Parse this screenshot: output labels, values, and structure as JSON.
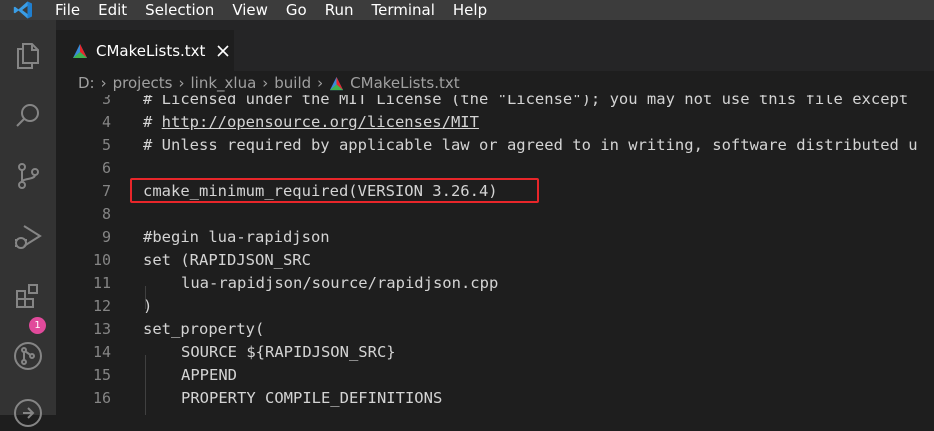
{
  "menubar": {
    "items": [
      "File",
      "Edit",
      "Selection",
      "View",
      "Go",
      "Run",
      "Terminal",
      "Help"
    ]
  },
  "activitybar": {
    "icons": [
      "explorer-icon",
      "search-icon",
      "source-control-icon",
      "run-debug-icon",
      "extensions-icon",
      "git-graph-icon",
      "remote-icon"
    ],
    "extensions_badge": "1"
  },
  "tab": {
    "label": "CMakeLists.txt",
    "close_label": "×"
  },
  "breadcrumb": [
    "D:",
    "projects",
    "link_xlua",
    "build",
    "CMakeLists.txt"
  ],
  "colors": {
    "activitybar": "#333333",
    "menubar": "#3c3c3c",
    "editor": "#1e1e1e",
    "highlight": "#e8262a",
    "badge": "#e14a9b"
  },
  "editor": {
    "lines": [
      {
        "n": "3",
        "text": "# Licensed under the MIT License (the \"License\"); you may not use this file except"
      },
      {
        "n": "4",
        "text": "# ",
        "url": "http://opensource.org/licenses/MIT"
      },
      {
        "n": "5",
        "text": "# Unless required by applicable law or agreed to in writing, software distributed u"
      },
      {
        "n": "6",
        "text": ""
      },
      {
        "n": "7",
        "text": "cmake_minimum_required(VERSION 3.26.4)"
      },
      {
        "n": "8",
        "text": ""
      },
      {
        "n": "9",
        "text": "#begin lua-rapidjson"
      },
      {
        "n": "10",
        "text": "set (RAPIDJSON_SRC"
      },
      {
        "n": "11",
        "text": "lua-rapidjson/source/rapidjson.cpp"
      },
      {
        "n": "12",
        "text": ")"
      },
      {
        "n": "13",
        "text": "set_property("
      },
      {
        "n": "14",
        "text": "SOURCE ${RAPIDJSON_SRC}"
      },
      {
        "n": "15",
        "text": "APPEND"
      },
      {
        "n": "16",
        "text": "PROPERTY COMPILE_DEFINITIONS"
      }
    ]
  }
}
